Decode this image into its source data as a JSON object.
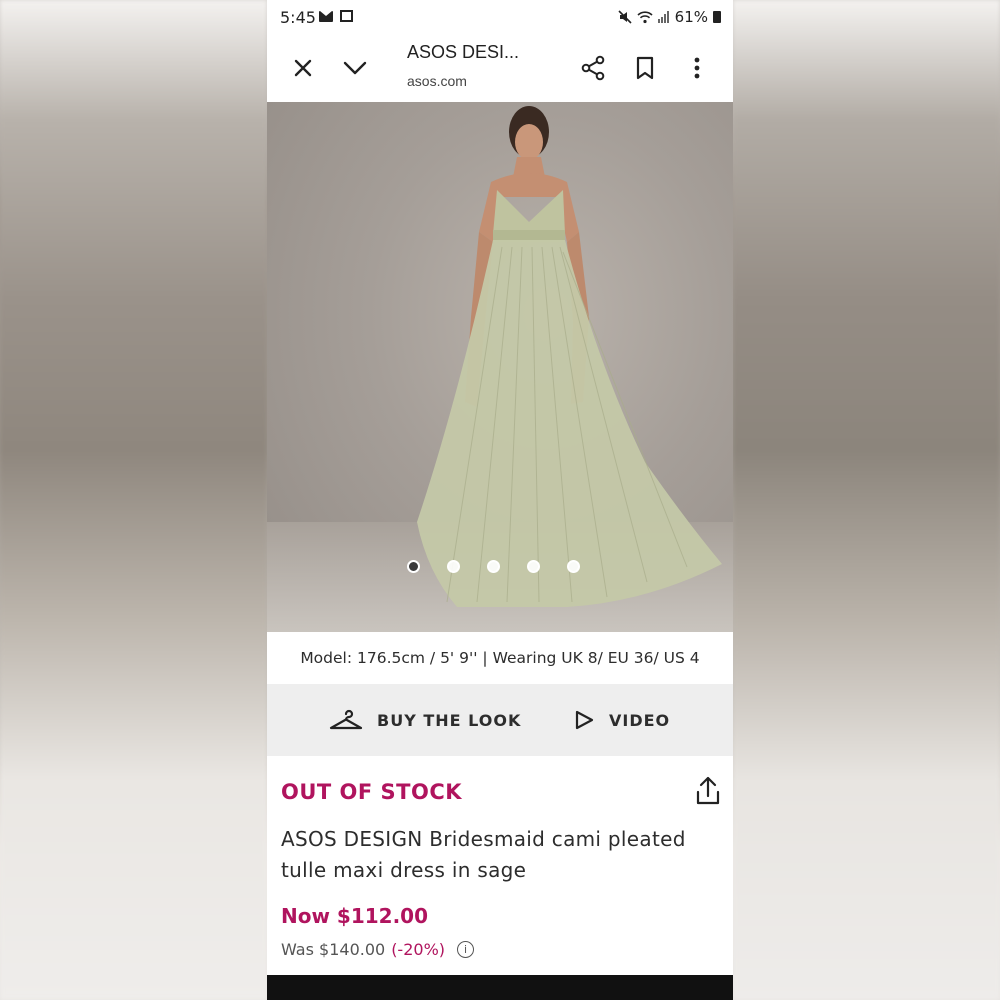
{
  "status_bar": {
    "time": "5:45",
    "battery": "61%"
  },
  "toolbar": {
    "title": "ASOS DESI...",
    "url": "asos.com",
    "icons": [
      "close-icon",
      "chevron-down-icon",
      "share-icon",
      "bookmark-icon",
      "more-vert-icon"
    ]
  },
  "gallery": {
    "dot_count": 5,
    "active_index": 0
  },
  "model_info": "Model: 176.5cm / 5' 9'' | Wearing UK 8/ EU 36/ US 4",
  "actions": {
    "buy_the_look": "BUY THE LOOK",
    "video": "VIDEO"
  },
  "product": {
    "stock_status": "OUT OF STOCK",
    "name": "ASOS DESIGN Bridesmaid cami pleated tulle maxi dress in sage",
    "now_price": "Now $112.00",
    "was_price": "Was $140.00",
    "discount": "(-20%)"
  },
  "colors": {
    "accent": "#b0145e",
    "dress": "#c4c8a8",
    "background": "#a59e98"
  }
}
